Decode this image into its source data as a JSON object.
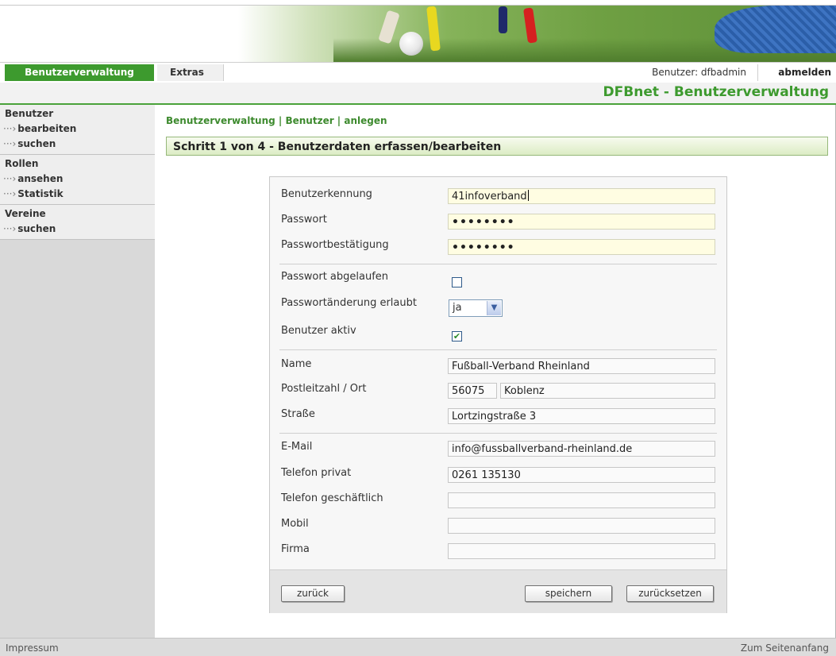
{
  "nav": {
    "tab_main": "Benutzerverwaltung",
    "tab_extras": "Extras",
    "user_label": "Benutzer: dfbadmin",
    "logout": "abmelden"
  },
  "app_title": "DFBnet - Benutzerverwaltung",
  "sidebar": {
    "groups": [
      {
        "title": "Benutzer",
        "items": [
          "bearbeiten",
          "suchen"
        ]
      },
      {
        "title": "Rollen",
        "items": [
          "ansehen",
          "Statistik"
        ]
      },
      {
        "title": "Vereine",
        "items": [
          "suchen"
        ]
      }
    ],
    "arrow": "→"
  },
  "breadcrumb": "Benutzerverwaltung | Benutzer | anlegen",
  "step_title": "Schritt 1 von 4 - Benutzerdaten erfassen/bearbeiten",
  "form": {
    "userid": {
      "label": "Benutzerkennung",
      "value": "41infoverband"
    },
    "password": {
      "label": "Passwort",
      "value": "••••••••"
    },
    "password_confirm": {
      "label": "Passwortbestätigung",
      "value": "••••••••"
    },
    "pw_expired": {
      "label": "Passwort abgelaufen",
      "checked": false
    },
    "pw_change": {
      "label": "Passwortänderung erlaubt",
      "value": "ja"
    },
    "user_active": {
      "label": "Benutzer aktiv",
      "checked": true,
      "mark": "✔"
    },
    "name": {
      "label": "Name",
      "value": "Fußball-Verband Rheinland"
    },
    "zip_city": {
      "label": "Postleitzahl / Ort",
      "zip": "56075",
      "city": "Koblenz"
    },
    "street": {
      "label": "Straße",
      "value": "Lortzingstraße 3"
    },
    "email": {
      "label": "E-Mail",
      "value": "info@fussballverband-rheinland.de"
    },
    "phone_private": {
      "label": "Telefon privat",
      "value": "0261 135130"
    },
    "phone_business": {
      "label": "Telefon geschäftlich",
      "value": ""
    },
    "mobile": {
      "label": "Mobil",
      "value": ""
    },
    "company": {
      "label": "Firma",
      "value": ""
    }
  },
  "buttons": {
    "back": "zurück",
    "save": "speichern",
    "reset": "zurücksetzen"
  },
  "footer": {
    "imprint": "Impressum",
    "to_top": "Zum Seitenanfang"
  },
  "colors": {
    "accent_green": "#3d9a2e",
    "input_yellow": "#fffde2"
  }
}
